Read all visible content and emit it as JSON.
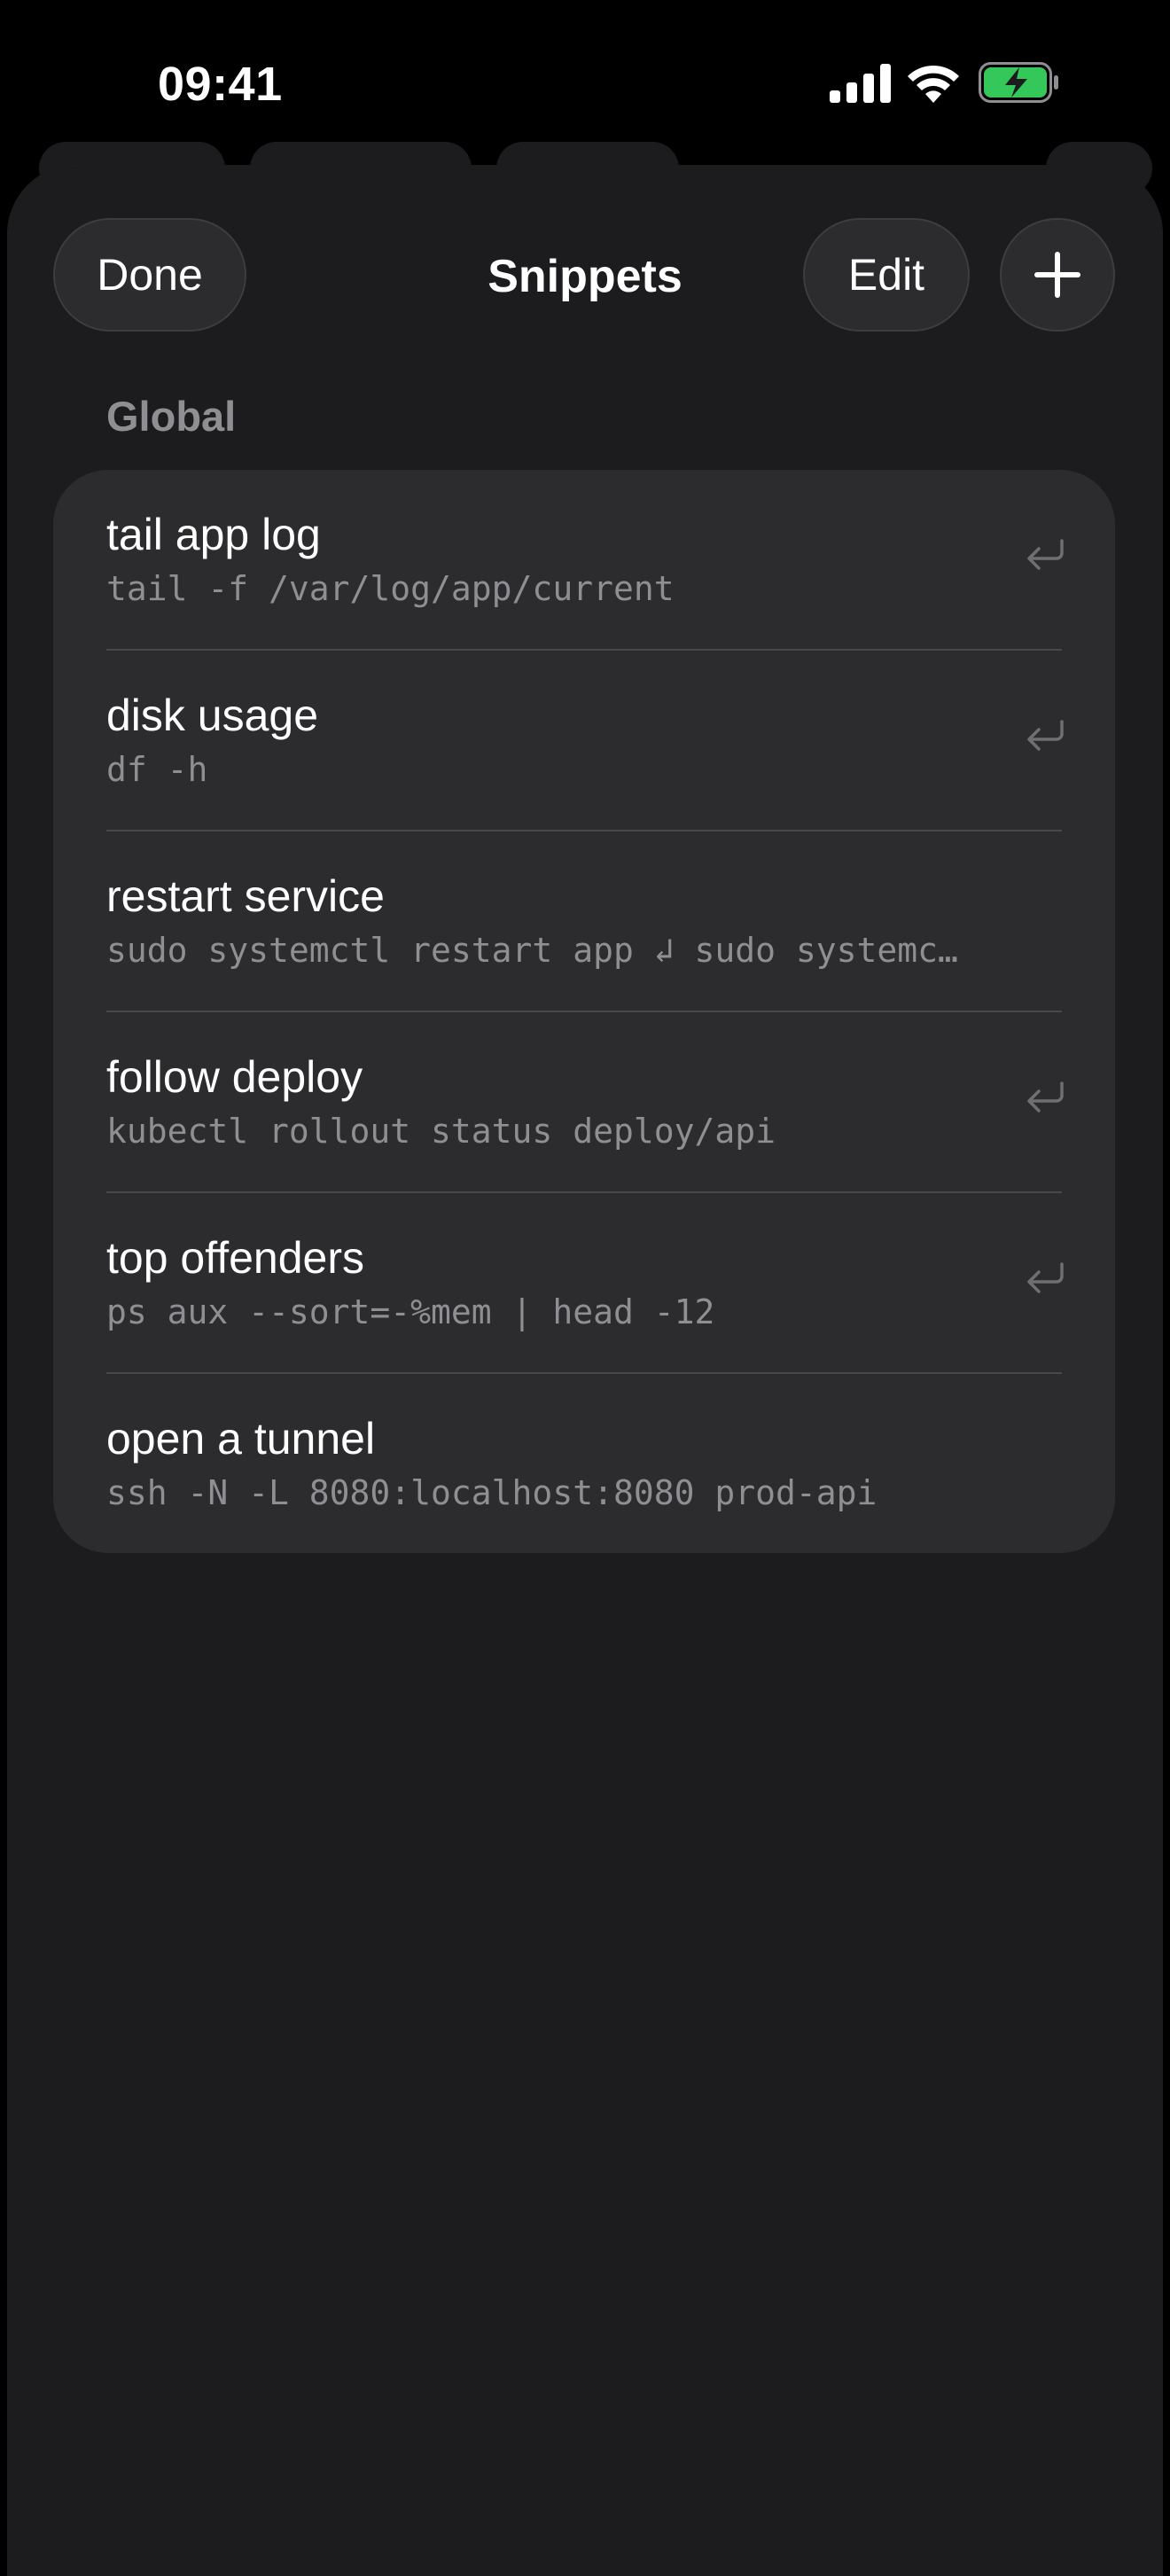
{
  "status_bar": {
    "time": "09:41"
  },
  "sheet": {
    "done_label": "Done",
    "title": "Snippets",
    "edit_label": "Edit",
    "add_icon": "plus-icon"
  },
  "section": {
    "header": "Global"
  },
  "snippets": [
    {
      "title": "tail app log",
      "command": "tail -f /var/log/app/current",
      "icon": "return-icon"
    },
    {
      "title": "disk usage",
      "command": "df -h",
      "icon": "return-icon"
    },
    {
      "title": "restart service",
      "command": "sudo systemctl restart app ↲ sudo systemc…",
      "icon": ""
    },
    {
      "title": "follow deploy",
      "command": "kubectl rollout status deploy/api",
      "icon": "return-icon"
    },
    {
      "title": "top offenders",
      "command": "ps aux --sort=-%mem | head -12",
      "icon": "return-icon"
    },
    {
      "title": "open a tunnel",
      "command": "ssh -N -L 8080:localhost:8080 prod-api",
      "icon": ""
    }
  ],
  "colors": {
    "background": "#1c1c1e",
    "group_background": "#2c2c2e",
    "secondary_text": "#8e8e93",
    "battery_fill": "#34c759"
  }
}
